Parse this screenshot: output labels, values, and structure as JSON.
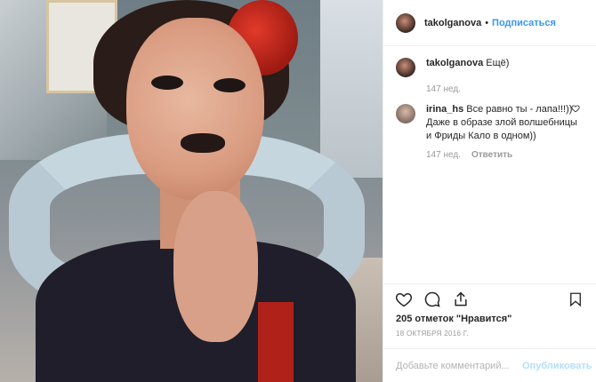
{
  "header": {
    "username": "takolganova",
    "separator": "•",
    "follow_label": "Подписаться"
  },
  "caption": {
    "username": "takolganova",
    "text": "Ещё)",
    "time": "147 нед."
  },
  "comment": {
    "username": "irina_hs",
    "text": "Все равно ты - лапа!!!)) Даже в образе злой волшебницы и Фриды Кало в одном))",
    "time": "147 нед.",
    "reply_label": "Ответить"
  },
  "likes_text": "205 отметок \"Нравится\"",
  "date": "18 ОКТЯБРЯ 2016 Г.",
  "add_comment": {
    "placeholder": "Добавьте комментарий...",
    "publish_label": "Опубликовать"
  },
  "colors": {
    "link_blue": "#3897f0",
    "publish_disabled": "#b2dffc",
    "text": "#262626",
    "muted": "#999999"
  },
  "icons": [
    "heart-icon",
    "comment-icon",
    "share-icon",
    "bookmark-icon"
  ]
}
